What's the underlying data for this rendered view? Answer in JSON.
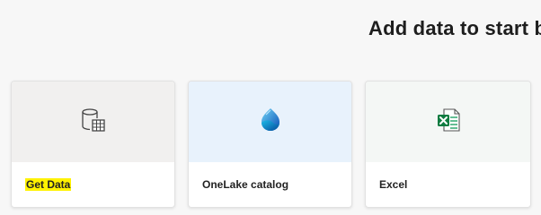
{
  "header": {
    "title": "Add data to start b"
  },
  "cards": [
    {
      "label": "Get Data",
      "icon": "database-table-icon",
      "top_color": "#f1f0ef",
      "highlight": "#fff200"
    },
    {
      "label": "OneLake catalog",
      "icon": "onelake-icon",
      "top_color": "#e8f2fc"
    },
    {
      "label": "Excel",
      "icon": "excel-icon",
      "top_color": "#f4f7f5"
    }
  ]
}
